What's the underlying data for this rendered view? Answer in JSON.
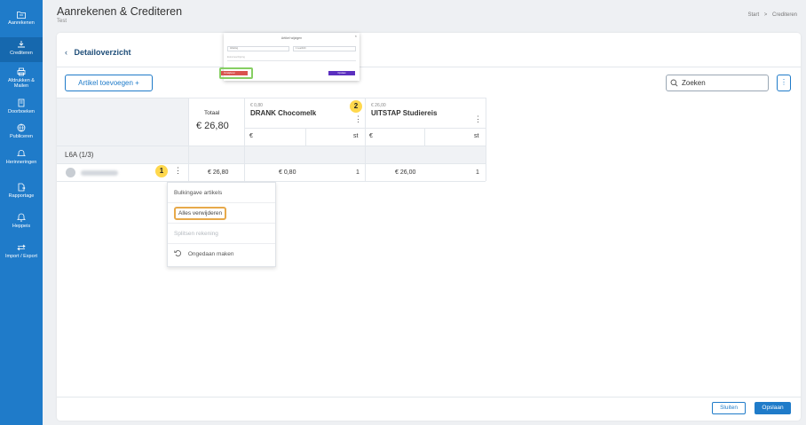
{
  "sidebar": {
    "items": [
      {
        "label": "Aanrekenen",
        "icon": "folder-icon"
      },
      {
        "label": "Crediteren",
        "icon": "credit-icon"
      },
      {
        "label": "Afdrukken & Mailen",
        "icon": "print-icon"
      },
      {
        "label": "Doorboeken",
        "icon": "book-icon"
      },
      {
        "label": "Publiceren",
        "icon": "globe-icon"
      },
      {
        "label": "Herinneringen",
        "icon": "bell-icon"
      },
      {
        "label": "Rapportage",
        "icon": "report-icon"
      },
      {
        "label": "Heppeis",
        "icon": "alert-icon"
      },
      {
        "label": "Import / Export",
        "icon": "swap-icon"
      }
    ],
    "active_index": 1,
    "color": "#1f7bc9"
  },
  "header": {
    "title": "Aanrekenen & Crediteren",
    "subtitle": "Test",
    "breadcrumb": [
      "Start",
      "Crediteren"
    ],
    "breadcrumb_sep": ">"
  },
  "main": {
    "title": "Detailoverzicht",
    "add_button": "Artikel toevoegen +",
    "search_placeholder": "Zoeken",
    "table": {
      "total_label": "Totaal",
      "total_value": "€ 26,80",
      "columns": [
        {
          "price": "€ 0,80",
          "name": "DRANK Chocomelk",
          "unit_left": "€",
          "unit_right": "st"
        },
        {
          "price": "€ 26,00",
          "name": "UITSTAP Studiereis",
          "unit_left": "€",
          "unit_right": "st"
        }
      ],
      "group": "L6A (1/3)",
      "row": {
        "total": "€ 26,80",
        "col1_amount": "€ 0,80",
        "col1_qty": "1",
        "col2_amount": "€ 26,00",
        "col2_qty": "1"
      }
    },
    "context_menu": {
      "items": [
        {
          "label": "Bulkingave artikels",
          "disabled": false
        },
        {
          "label": "Alles verwijderen",
          "disabled": false,
          "highlighted": true
        },
        {
          "label": "Splitsen rekening",
          "disabled": true
        },
        {
          "label": "Ongedaan maken",
          "disabled": false
        }
      ]
    },
    "badges": [
      "1",
      "2"
    ],
    "dialog_preview": {
      "title": "Artikel wijzigen",
      "select_left": "Afdeling",
      "select_right": "1 Leerlinhi",
      "input_placeholder": "Extra beschrijving",
      "delete_button": "Verwijderen",
      "confirm_button": "Opslaan"
    },
    "footer": {
      "close_button": "Sluiten",
      "save_button": "Opslaan"
    }
  },
  "colors": {
    "accent": "#1f7bc9",
    "badge": "#ffd84d",
    "highlight_orange": "#e7a94a",
    "highlight_green": "#86cf63"
  }
}
